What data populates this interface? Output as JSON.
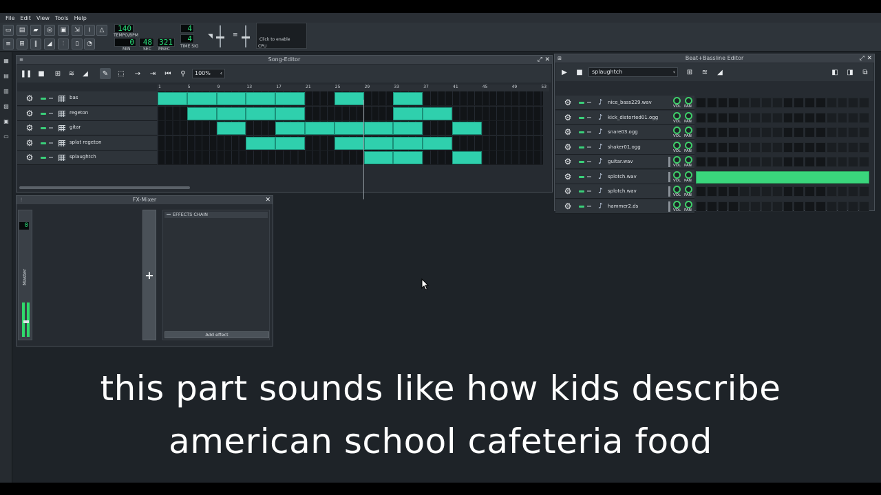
{
  "menu": [
    "File",
    "Edit",
    "View",
    "Tools",
    "Help"
  ],
  "toolbar": {
    "tempo_value": "140",
    "tempo_label": "TEMPO/BPM",
    "time_min": "0",
    "time_sec": "48",
    "time_msec": "321",
    "min_label": "MIN",
    "sec_label": "SEC",
    "msec_label": "MSEC",
    "timesig_num": "4",
    "timesig_den": "4",
    "timesig_label": "TIME SIG",
    "cpu_text": "Click to enable",
    "cpu_label": "CPU"
  },
  "song_editor": {
    "title": "Song-Editor",
    "zoom": "100%",
    "ruler": [
      "1",
      "5",
      "9",
      "13",
      "17",
      "21",
      "25",
      "29",
      "33",
      "37",
      "41",
      "45",
      "49",
      "53"
    ],
    "tracks": [
      {
        "name": "bas",
        "clips": [
          [
            1,
            4
          ],
          [
            5,
            8
          ],
          [
            9,
            12
          ],
          [
            13,
            16
          ],
          [
            17,
            20
          ],
          [
            25,
            28
          ],
          [
            33,
            36
          ]
        ]
      },
      {
        "name": "regeton",
        "clips": [
          [
            5,
            8
          ],
          [
            9,
            12
          ],
          [
            13,
            16
          ],
          [
            17,
            20
          ],
          [
            33,
            36
          ],
          [
            37,
            40
          ]
        ]
      },
      {
        "name": "gitar",
        "clips": [
          [
            9,
            12
          ],
          [
            17,
            20
          ],
          [
            21,
            24
          ],
          [
            25,
            28
          ],
          [
            29,
            32
          ],
          [
            33,
            36
          ],
          [
            41,
            44
          ]
        ]
      },
      {
        "name": "splat regeton",
        "clips": [
          [
            13,
            16
          ],
          [
            17,
            20
          ],
          [
            25,
            28
          ],
          [
            29,
            32
          ],
          [
            33,
            36
          ],
          [
            37,
            40
          ]
        ]
      },
      {
        "name": "splaughtch",
        "clips": [
          [
            29,
            32
          ],
          [
            33,
            36
          ],
          [
            41,
            44
          ]
        ]
      }
    ]
  },
  "bb_editor": {
    "title": "Beat+Bassline Editor",
    "pattern": "splaughtch",
    "vol_label": "VOL",
    "pan_label": "PAN",
    "tracks": [
      {
        "name": "nice_bass229.wav",
        "filled": false,
        "bar": false
      },
      {
        "name": "kick_distorted01.ogg",
        "filled": false,
        "bar": false
      },
      {
        "name": "snare03.ogg",
        "filled": false,
        "bar": false
      },
      {
        "name": "shaker01.ogg",
        "filled": false,
        "bar": false
      },
      {
        "name": "guitar.wav",
        "filled": false,
        "bar": true
      },
      {
        "name": "splotch.wav",
        "filled": true,
        "bar": true
      },
      {
        "name": "splotch.wav",
        "filled": false,
        "bar": true
      },
      {
        "name": "hammer2.ds",
        "filled": false,
        "bar": true
      }
    ]
  },
  "fx_mixer": {
    "title": "FX-Mixer",
    "master_value": "0",
    "master_label": "Master",
    "add_channel": "+",
    "effects_chain": "EFFECTS CHAIN",
    "add_effect": "Add effect"
  },
  "caption": {
    "line1": "this part sounds like how kids describe",
    "line2": "american school cafeteria food"
  },
  "colors": {
    "clip": "#2fd0ad",
    "step_on": "#3ad67c",
    "lcd_text": "#29e07a",
    "knob": "#3fcf6a"
  }
}
